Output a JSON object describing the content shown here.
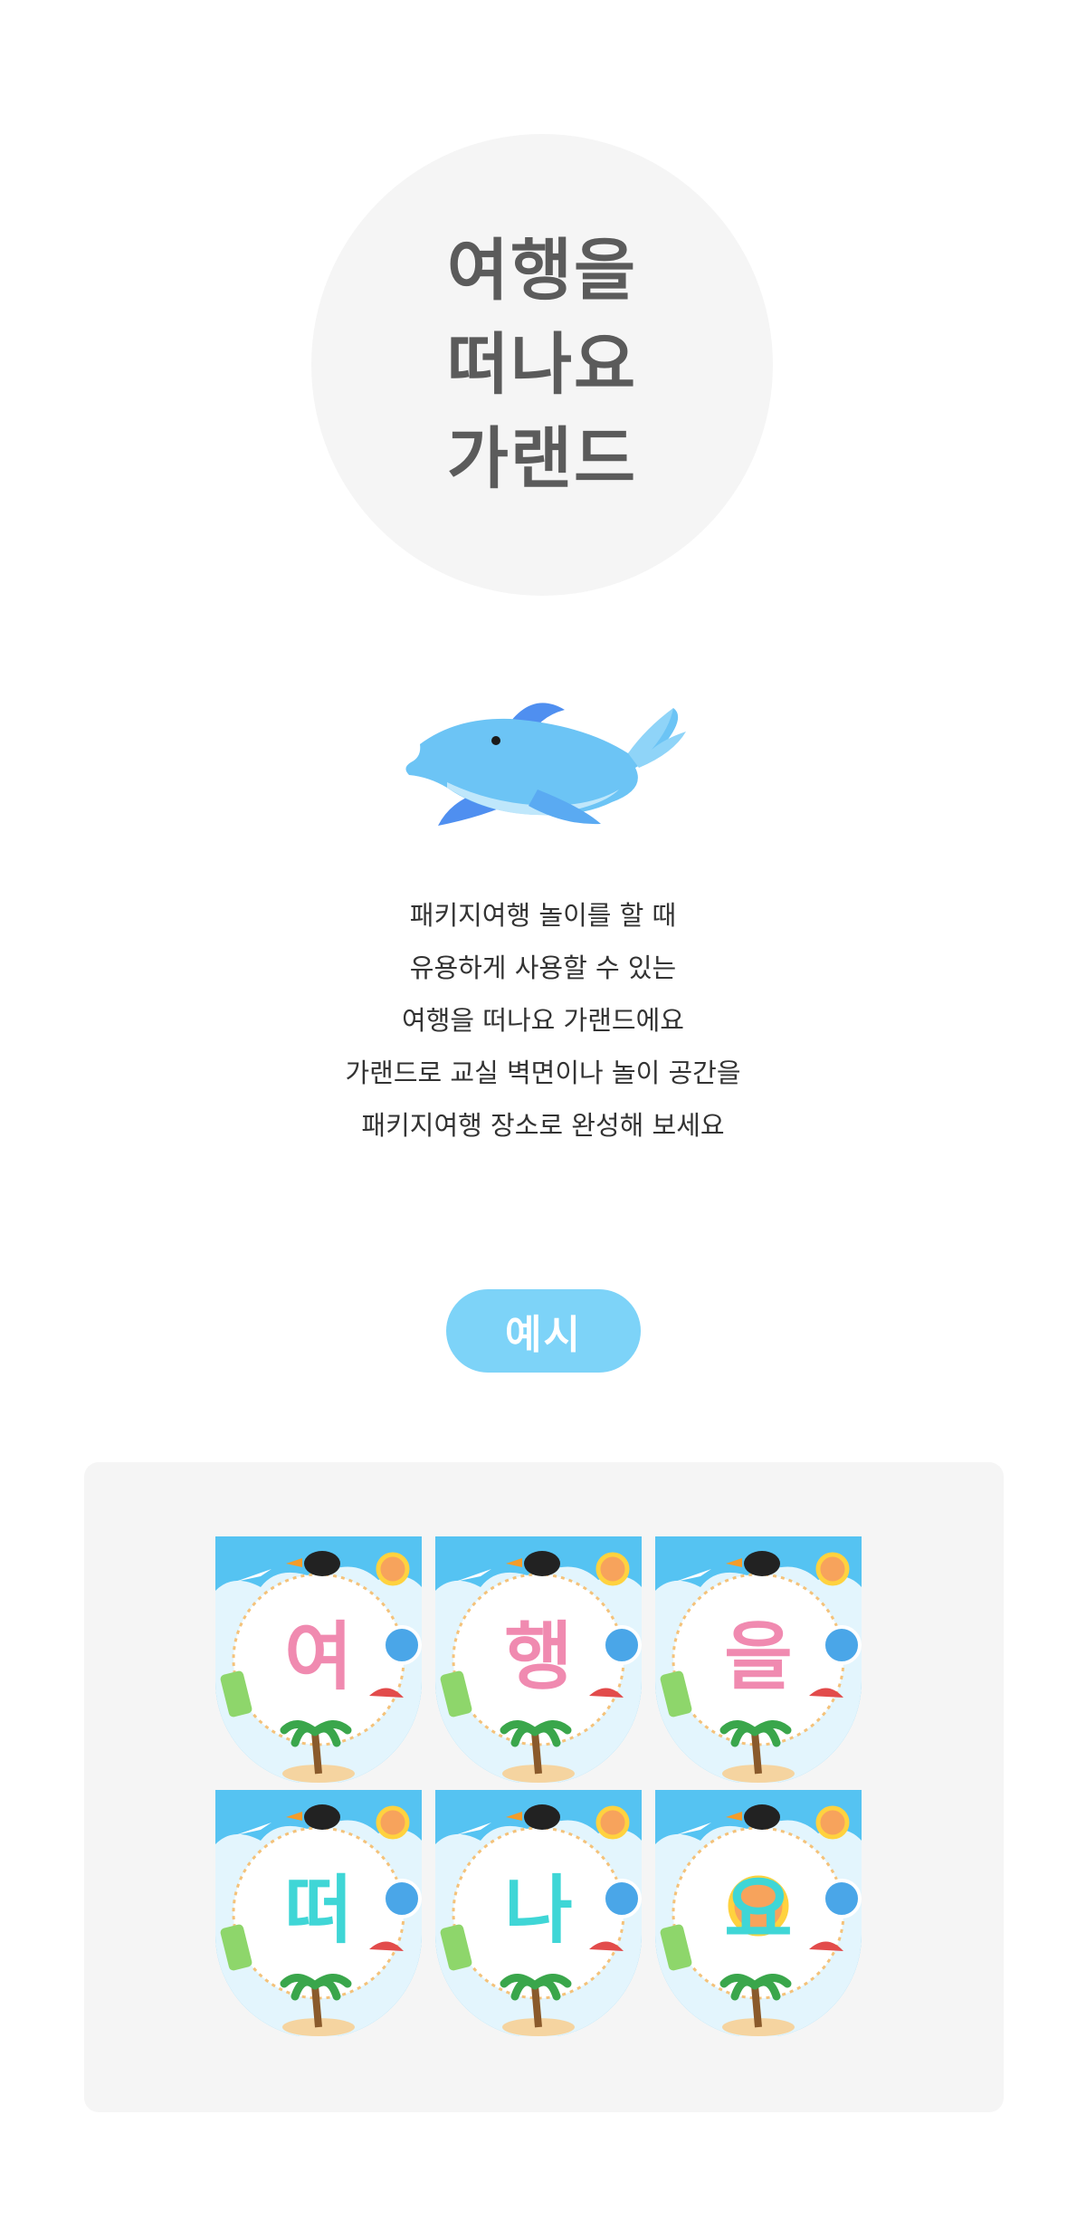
{
  "hero": {
    "title_lines": [
      "여행을",
      "떠나요",
      "가랜드"
    ]
  },
  "illustration": {
    "icon": "dolphin-icon"
  },
  "description": {
    "lines": [
      "패키지여행 놀이를 할 때",
      "유용하게 사용할 수 있는",
      "여행을 떠나요 가랜드에요",
      "가랜드로 교실 벽면이나 놀이 공간을",
      "패키지여행 장소로 완성해 보세요"
    ]
  },
  "example": {
    "label": "예시",
    "flags": [
      {
        "letter": "여",
        "color": "#f08ab0"
      },
      {
        "letter": "행",
        "color": "#f08ab0"
      },
      {
        "letter": "을",
        "color": "#f08ab0"
      },
      {
        "letter": "떠",
        "color": "#3fd6d6"
      },
      {
        "letter": "나",
        "color": "#3fd6d6"
      },
      {
        "letter": "요",
        "color": "#3fd6d6"
      }
    ]
  },
  "colors": {
    "accent": "#7dd3f8",
    "title_text": "#5b5b5b",
    "panel_background": "#f5f5f5",
    "flag_sky": "#55c3f2"
  }
}
